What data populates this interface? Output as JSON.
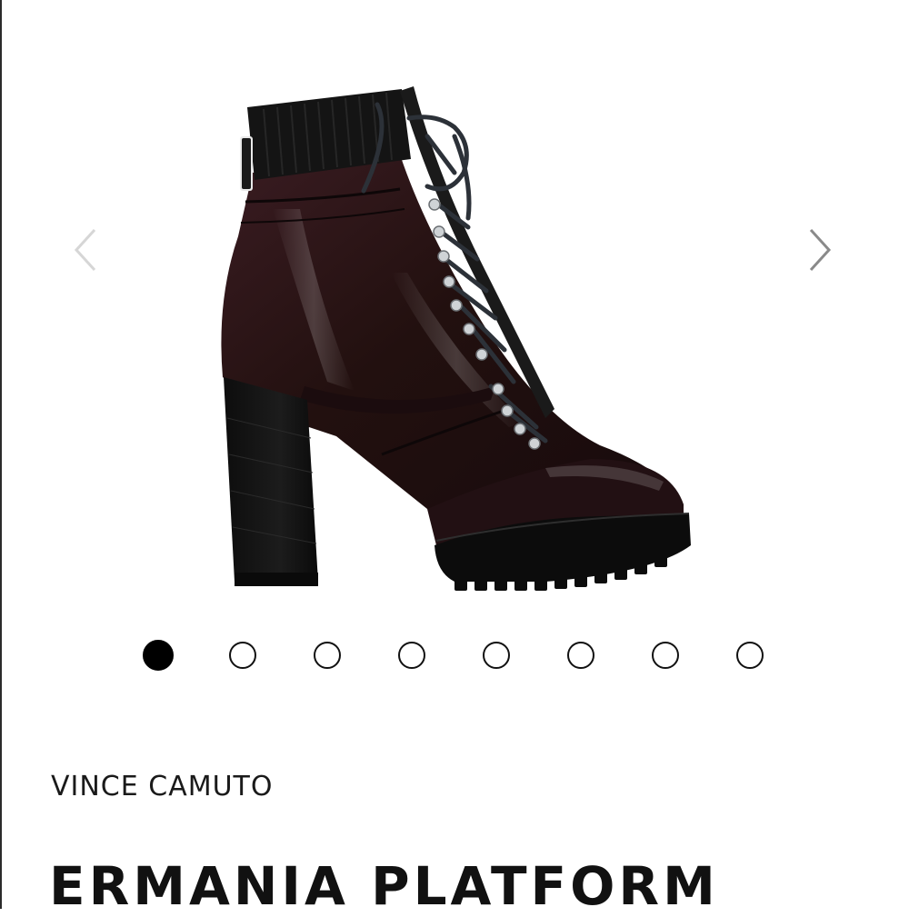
{
  "carousel": {
    "image_alt": "Ermania platform lace-up bootie",
    "prev_icon": "chevron-left-icon",
    "next_icon": "chevron-right-icon",
    "dots": [
      {
        "active": true
      },
      {
        "active": false
      },
      {
        "active": false
      },
      {
        "active": false
      },
      {
        "active": false
      },
      {
        "active": false
      },
      {
        "active": false
      },
      {
        "active": false
      }
    ]
  },
  "product": {
    "brand": "VINCE CAMUTO",
    "title": "ERMANIA PLATFORM"
  },
  "colors": {
    "text": "#111111",
    "arrow": "#8a8a8a",
    "arrow_disabled": "#d6d6d6",
    "boot_leather": "#2a1418"
  }
}
